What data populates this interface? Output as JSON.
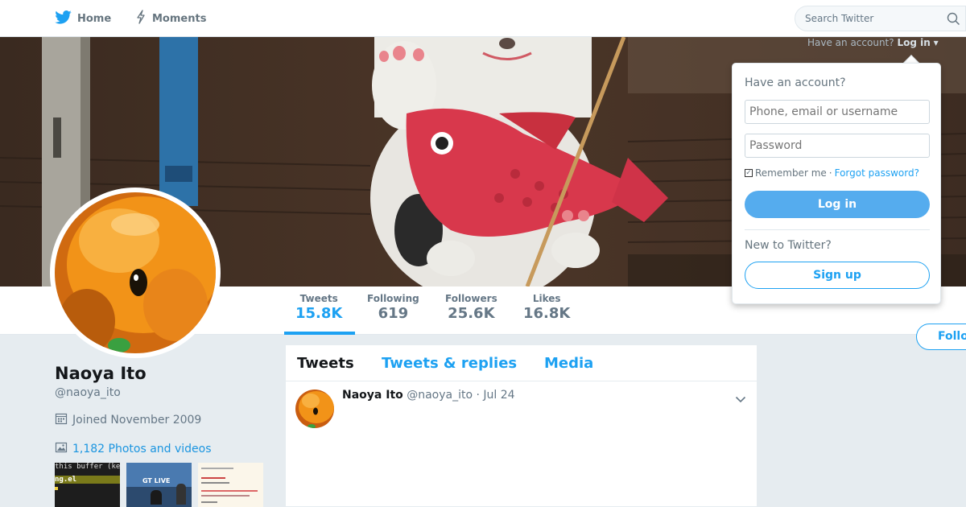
{
  "nav": {
    "home_label": "Home",
    "moments_label": "Moments",
    "search_placeholder": "Search Twitter"
  },
  "login_hint": {
    "prefix": "Have an account?",
    "link": "Log in",
    "caret": "▾"
  },
  "profile": {
    "name": "Naoya Ito",
    "handle": "@naoya_ito",
    "joined": "Joined November 2009",
    "photos_link": "1,182 Photos and videos"
  },
  "stats": [
    {
      "label": "Tweets",
      "value": "15.8K",
      "active": true
    },
    {
      "label": "Following",
      "value": "619"
    },
    {
      "label": "Followers",
      "value": "25.6K"
    },
    {
      "label": "Likes",
      "value": "16.8K"
    }
  ],
  "follow_label": "Follow",
  "tabs": [
    {
      "label": "Tweets",
      "active": true
    },
    {
      "label": "Tweets & replies"
    },
    {
      "label": "Media"
    }
  ],
  "tweet": {
    "name": "Naoya Ito",
    "meta": "@naoya_ito · Jul 24"
  },
  "thumbnails": {
    "thumb1_lines": [
      "this buffer (ke",
      "ng.el"
    ],
    "thumb2_text": "GT LIVE"
  },
  "dropdown": {
    "heading": "Have an account?",
    "username_placeholder": "Phone, email or username",
    "password_placeholder": "Password",
    "remember": "Remember me",
    "separator": "·",
    "forgot": "Forgot password?",
    "login_button": "Log in",
    "new_heading": "New to Twitter?",
    "signup_button": "Sign up"
  },
  "colors": {
    "accent": "#1da1f2",
    "login_button": "#55acee",
    "background": "#e6ecf0"
  },
  "icons": [
    "twitter-bird-icon",
    "moments-lightning-icon",
    "search-icon",
    "calendar-icon",
    "photo-icon",
    "chevron-down-icon"
  ]
}
